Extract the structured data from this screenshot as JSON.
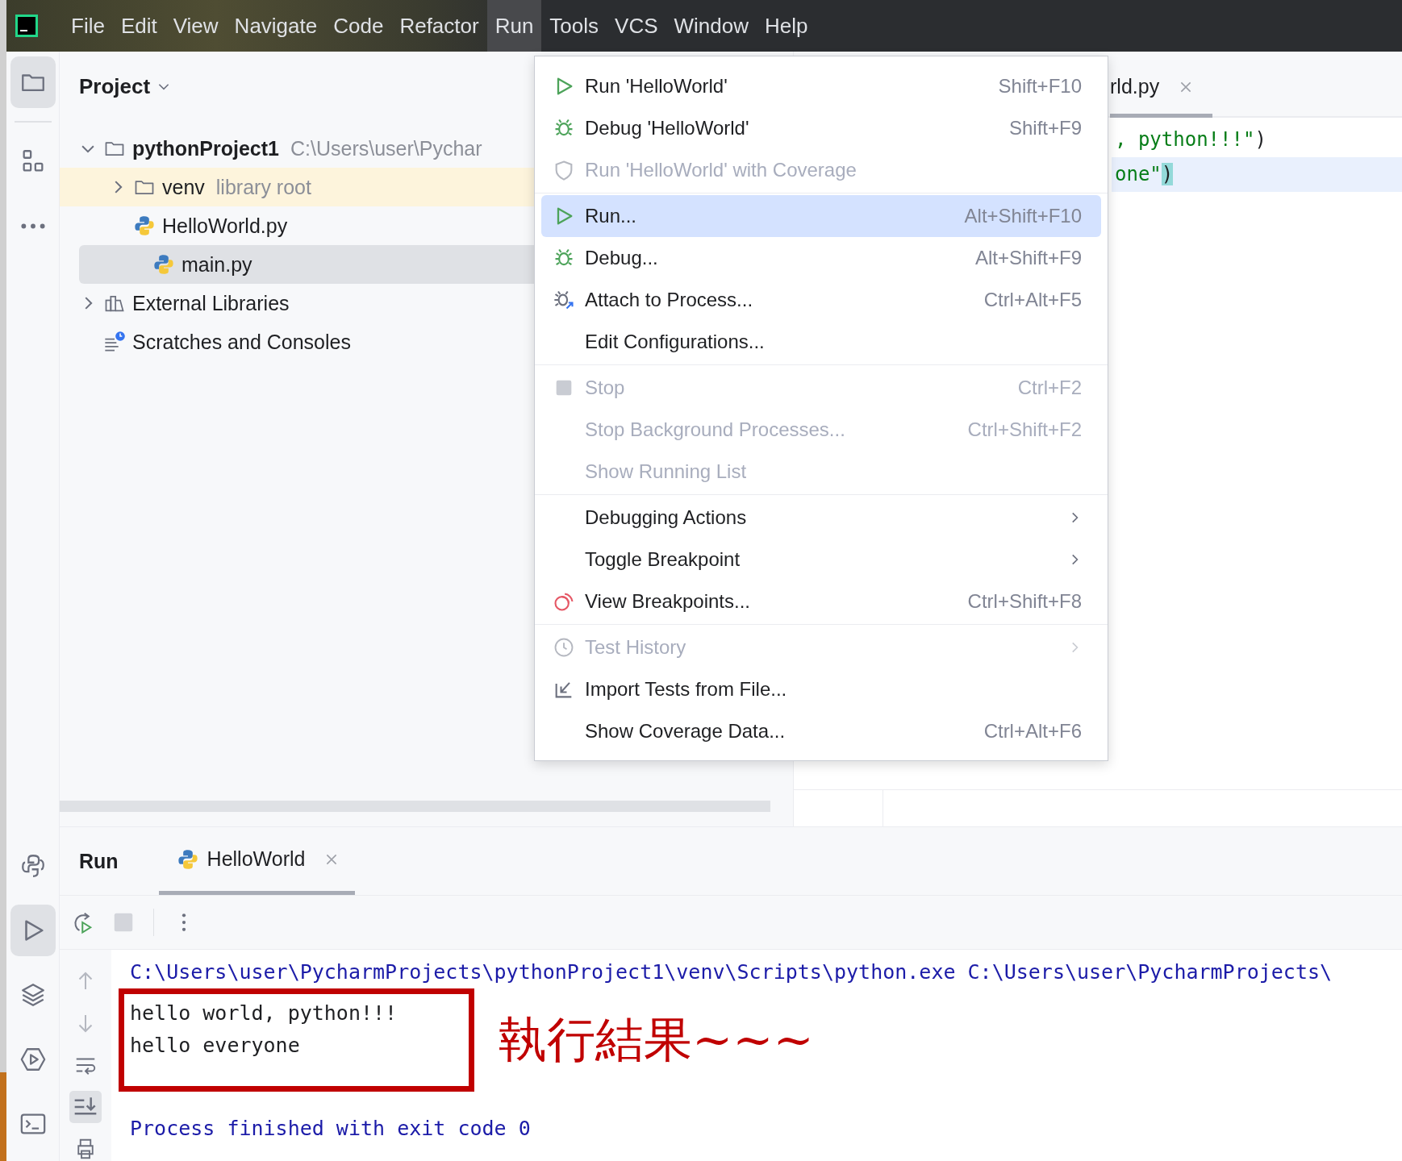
{
  "menu_bar": {
    "items": [
      {
        "label": "File",
        "selected": false
      },
      {
        "label": "Edit",
        "selected": false
      },
      {
        "label": "View",
        "selected": false
      },
      {
        "label": "Navigate",
        "selected": false
      },
      {
        "label": "Code",
        "selected": false
      },
      {
        "label": "Refactor",
        "selected": false
      },
      {
        "label": "Run",
        "selected": true
      },
      {
        "label": "Tools",
        "selected": false
      },
      {
        "label": "VCS",
        "selected": false
      },
      {
        "label": "Window",
        "selected": false
      },
      {
        "label": "Help",
        "selected": false
      }
    ]
  },
  "project_panel": {
    "title": "Project",
    "tree": [
      {
        "label": "pythonProject1",
        "detail": "C:\\Users\\user\\Pychar",
        "kind": "folder",
        "bold": true,
        "expanded": true,
        "selected": false,
        "highlighted": false,
        "children": [
          {
            "label": "venv",
            "detail": "library root",
            "kind": "folder",
            "expanded": false,
            "selected": false,
            "highlighted": true
          },
          {
            "label": "HelloWorld.py",
            "kind": "python_file",
            "selected": false,
            "highlighted": false
          },
          {
            "label": "main.py",
            "kind": "python_file",
            "selected": true,
            "highlighted": false
          }
        ]
      },
      {
        "label": "External Libraries",
        "kind": "libraries",
        "expanded": false,
        "selected": false,
        "highlighted": false
      },
      {
        "label": "Scratches and Consoles",
        "kind": "scratches",
        "selected": false,
        "highlighted": false
      }
    ]
  },
  "editor": {
    "tab": {
      "label": "rld.py",
      "selected": true
    },
    "lines": [
      {
        "current": false,
        "parts": [
          {
            "text": ", python!!!\"",
            "kind": "string"
          },
          {
            "text": ")",
            "kind": "plain"
          }
        ]
      },
      {
        "current": true,
        "parts": [
          {
            "text": "one\"",
            "kind": "string"
          },
          {
            "text": ")",
            "kind": "brace_match"
          }
        ]
      }
    ]
  },
  "run_menu": {
    "groups": [
      [
        {
          "label": "Run 'HelloWorld'",
          "shortcut": "Shift+F10",
          "kind": "run",
          "disabled": false,
          "selected": false
        },
        {
          "label": "Debug 'HelloWorld'",
          "shortcut": "Shift+F9",
          "kind": "debug",
          "disabled": false,
          "selected": false
        },
        {
          "label": "Run 'HelloWorld' with Coverage",
          "kind": "coverage",
          "disabled": true,
          "selected": false
        }
      ],
      [
        {
          "label": "Run...",
          "shortcut": "Alt+Shift+F10",
          "kind": "run",
          "disabled": false,
          "selected": true
        },
        {
          "label": "Debug...",
          "shortcut": "Alt+Shift+F9",
          "kind": "debug",
          "disabled": false,
          "selected": false
        },
        {
          "label": "Attach to Process...",
          "shortcut": "Ctrl+Alt+F5",
          "kind": "attach",
          "disabled": false,
          "selected": false
        },
        {
          "label": "Edit Configurations...",
          "disabled": false,
          "selected": false
        }
      ],
      [
        {
          "label": "Stop",
          "shortcut": "Ctrl+F2",
          "kind": "stop",
          "disabled": true,
          "selected": false
        },
        {
          "label": "Stop Background Processes...",
          "shortcut": "Ctrl+Shift+F2",
          "disabled": true,
          "selected": false
        },
        {
          "label": "Show Running List",
          "disabled": true,
          "selected": false
        }
      ],
      [
        {
          "label": "Debugging Actions",
          "submenu": true,
          "disabled": false,
          "selected": false
        },
        {
          "label": "Toggle Breakpoint",
          "submenu": true,
          "disabled": false,
          "selected": false
        },
        {
          "label": "View Breakpoints...",
          "shortcut": "Ctrl+Shift+F8",
          "kind": "breakpoints",
          "disabled": false,
          "selected": false
        }
      ],
      [
        {
          "label": "Test History",
          "kind": "history",
          "submenu": true,
          "disabled": true,
          "selected": false
        },
        {
          "label": "Import Tests from File...",
          "kind": "import",
          "disabled": false,
          "selected": false
        },
        {
          "label": "Show Coverage Data...",
          "shortcut": "Ctrl+Alt+F6",
          "disabled": false,
          "selected": false
        }
      ]
    ]
  },
  "run_panel": {
    "title": "Run",
    "tabs": [
      {
        "label": "HelloWorld",
        "selected": true
      }
    ],
    "console": {
      "lines": [
        {
          "text": "C:\\Users\\user\\PycharmProjects\\pythonProject1\\venv\\Scripts\\python.exe C:\\Users\\user\\PycharmProjects\\",
          "kind": "command"
        },
        {
          "text": "hello world, python!!!",
          "kind": "output"
        },
        {
          "text": "hello everyone",
          "kind": "output"
        },
        {
          "text": "Process finished with exit code 0",
          "kind": "status"
        }
      ]
    },
    "annotation": {
      "text": "執行結果~~~"
    }
  }
}
